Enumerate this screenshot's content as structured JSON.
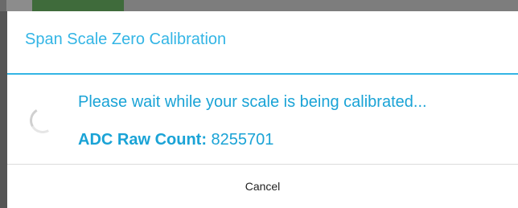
{
  "dialog": {
    "title": "Span Scale Zero Calibration",
    "message": "Please wait while your scale is being calibrated...",
    "adc_label": "ADC Raw Count:",
    "adc_value": "8255701",
    "cancel_label": "Cancel",
    "spinner_icon": "progress-spinner-icon"
  },
  "colors": {
    "accent": "#33b5e5",
    "text_accent": "#1aa3d6",
    "button_text": "#222222",
    "backdrop_green": "#3f6b3b"
  }
}
